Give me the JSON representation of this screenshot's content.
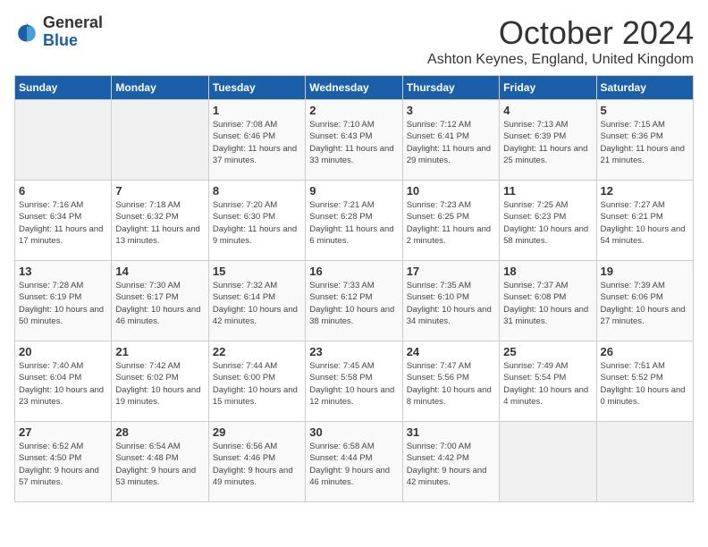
{
  "logo": {
    "general": "General",
    "blue": "Blue"
  },
  "header": {
    "month": "October 2024",
    "location": "Ashton Keynes, England, United Kingdom"
  },
  "days_of_week": [
    "Sunday",
    "Monday",
    "Tuesday",
    "Wednesday",
    "Thursday",
    "Friday",
    "Saturday"
  ],
  "weeks": [
    [
      {
        "day": "",
        "content": ""
      },
      {
        "day": "",
        "content": ""
      },
      {
        "day": "1",
        "content": "Sunrise: 7:08 AM\nSunset: 6:46 PM\nDaylight: 11 hours and 37 minutes."
      },
      {
        "day": "2",
        "content": "Sunrise: 7:10 AM\nSunset: 6:43 PM\nDaylight: 11 hours and 33 minutes."
      },
      {
        "day": "3",
        "content": "Sunrise: 7:12 AM\nSunset: 6:41 PM\nDaylight: 11 hours and 29 minutes."
      },
      {
        "day": "4",
        "content": "Sunrise: 7:13 AM\nSunset: 6:39 PM\nDaylight: 11 hours and 25 minutes."
      },
      {
        "day": "5",
        "content": "Sunrise: 7:15 AM\nSunset: 6:36 PM\nDaylight: 11 hours and 21 minutes."
      }
    ],
    [
      {
        "day": "6",
        "content": "Sunrise: 7:16 AM\nSunset: 6:34 PM\nDaylight: 11 hours and 17 minutes."
      },
      {
        "day": "7",
        "content": "Sunrise: 7:18 AM\nSunset: 6:32 PM\nDaylight: 11 hours and 13 minutes."
      },
      {
        "day": "8",
        "content": "Sunrise: 7:20 AM\nSunset: 6:30 PM\nDaylight: 11 hours and 9 minutes."
      },
      {
        "day": "9",
        "content": "Sunrise: 7:21 AM\nSunset: 6:28 PM\nDaylight: 11 hours and 6 minutes."
      },
      {
        "day": "10",
        "content": "Sunrise: 7:23 AM\nSunset: 6:25 PM\nDaylight: 11 hours and 2 minutes."
      },
      {
        "day": "11",
        "content": "Sunrise: 7:25 AM\nSunset: 6:23 PM\nDaylight: 10 hours and 58 minutes."
      },
      {
        "day": "12",
        "content": "Sunrise: 7:27 AM\nSunset: 6:21 PM\nDaylight: 10 hours and 54 minutes."
      }
    ],
    [
      {
        "day": "13",
        "content": "Sunrise: 7:28 AM\nSunset: 6:19 PM\nDaylight: 10 hours and 50 minutes."
      },
      {
        "day": "14",
        "content": "Sunrise: 7:30 AM\nSunset: 6:17 PM\nDaylight: 10 hours and 46 minutes."
      },
      {
        "day": "15",
        "content": "Sunrise: 7:32 AM\nSunset: 6:14 PM\nDaylight: 10 hours and 42 minutes."
      },
      {
        "day": "16",
        "content": "Sunrise: 7:33 AM\nSunset: 6:12 PM\nDaylight: 10 hours and 38 minutes."
      },
      {
        "day": "17",
        "content": "Sunrise: 7:35 AM\nSunset: 6:10 PM\nDaylight: 10 hours and 34 minutes."
      },
      {
        "day": "18",
        "content": "Sunrise: 7:37 AM\nSunset: 6:08 PM\nDaylight: 10 hours and 31 minutes."
      },
      {
        "day": "19",
        "content": "Sunrise: 7:39 AM\nSunset: 6:06 PM\nDaylight: 10 hours and 27 minutes."
      }
    ],
    [
      {
        "day": "20",
        "content": "Sunrise: 7:40 AM\nSunset: 6:04 PM\nDaylight: 10 hours and 23 minutes."
      },
      {
        "day": "21",
        "content": "Sunrise: 7:42 AM\nSunset: 6:02 PM\nDaylight: 10 hours and 19 minutes."
      },
      {
        "day": "22",
        "content": "Sunrise: 7:44 AM\nSunset: 6:00 PM\nDaylight: 10 hours and 15 minutes."
      },
      {
        "day": "23",
        "content": "Sunrise: 7:45 AM\nSunset: 5:58 PM\nDaylight: 10 hours and 12 minutes."
      },
      {
        "day": "24",
        "content": "Sunrise: 7:47 AM\nSunset: 5:56 PM\nDaylight: 10 hours and 8 minutes."
      },
      {
        "day": "25",
        "content": "Sunrise: 7:49 AM\nSunset: 5:54 PM\nDaylight: 10 hours and 4 minutes."
      },
      {
        "day": "26",
        "content": "Sunrise: 7:51 AM\nSunset: 5:52 PM\nDaylight: 10 hours and 0 minutes."
      }
    ],
    [
      {
        "day": "27",
        "content": "Sunrise: 6:52 AM\nSunset: 4:50 PM\nDaylight: 9 hours and 57 minutes."
      },
      {
        "day": "28",
        "content": "Sunrise: 6:54 AM\nSunset: 4:48 PM\nDaylight: 9 hours and 53 minutes."
      },
      {
        "day": "29",
        "content": "Sunrise: 6:56 AM\nSunset: 4:46 PM\nDaylight: 9 hours and 49 minutes."
      },
      {
        "day": "30",
        "content": "Sunrise: 6:58 AM\nSunset: 4:44 PM\nDaylight: 9 hours and 46 minutes."
      },
      {
        "day": "31",
        "content": "Sunrise: 7:00 AM\nSunset: 4:42 PM\nDaylight: 9 hours and 42 minutes."
      },
      {
        "day": "",
        "content": ""
      },
      {
        "day": "",
        "content": ""
      }
    ]
  ]
}
